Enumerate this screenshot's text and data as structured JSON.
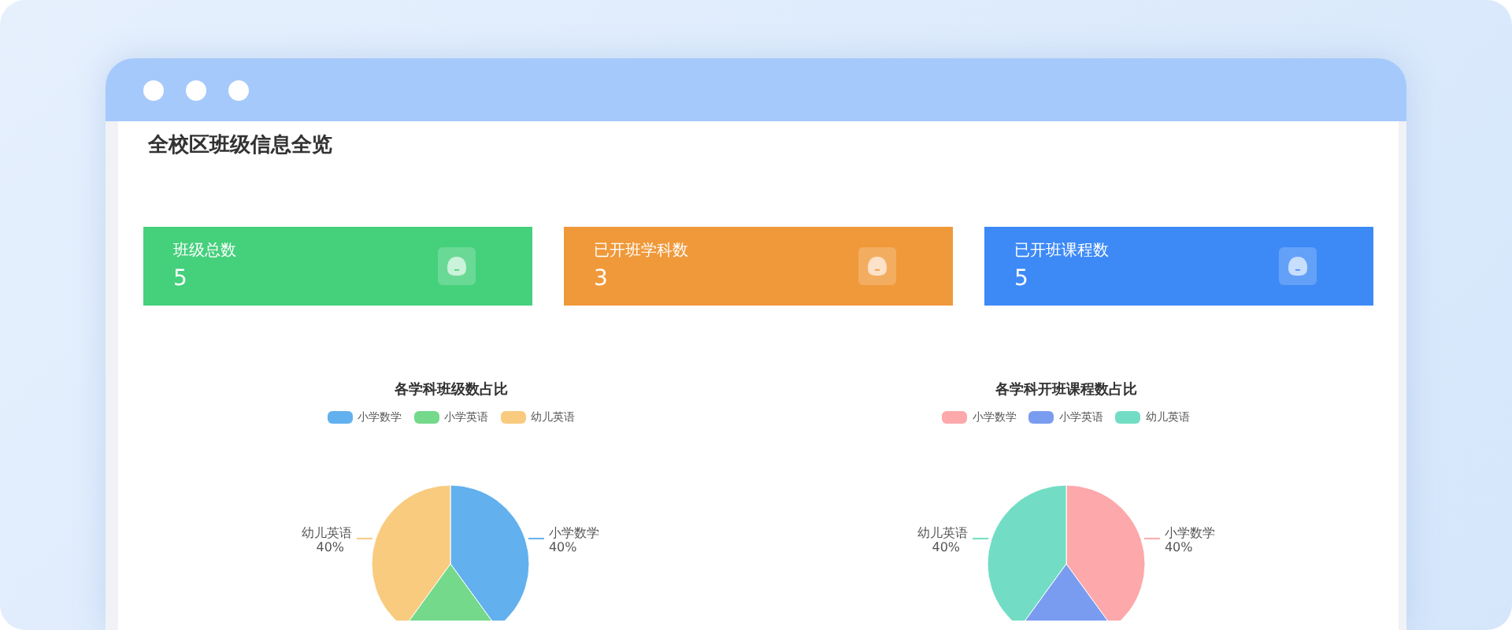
{
  "window": {
    "title": "全校区班级信息全览"
  },
  "stats": [
    {
      "label": "班级总数",
      "value": "5",
      "color": "#45d07c"
    },
    {
      "label": "已开班学科数",
      "value": "3",
      "color": "#f0993a"
    },
    {
      "label": "已开班课程数",
      "value": "5",
      "color": "#3d8af7"
    }
  ],
  "charts": [
    {
      "chart_data": {
        "type": "pie",
        "title": "各学科班级数占比",
        "legend": "top",
        "categories": [
          "小学数学",
          "小学英语",
          "幼儿英语"
        ],
        "series": [
          {
            "values": [
              40,
              20,
              40
            ]
          }
        ],
        "colors": [
          "#62b0ee",
          "#74d98b",
          "#f8cb7f"
        ],
        "value_labels": [
          "40%",
          null,
          "40%"
        ]
      }
    },
    {
      "chart_data": {
        "type": "pie",
        "title": "各学科开班课程数占比",
        "legend": "top",
        "categories": [
          "小学数学",
          "小学英语",
          "幼儿英语"
        ],
        "series": [
          {
            "values": [
              40,
              20,
              40
            ]
          }
        ],
        "colors": [
          "#fda8aa",
          "#7a9cf0",
          "#72ddc4"
        ],
        "value_labels": [
          "40%",
          null,
          "40%"
        ]
      }
    }
  ]
}
